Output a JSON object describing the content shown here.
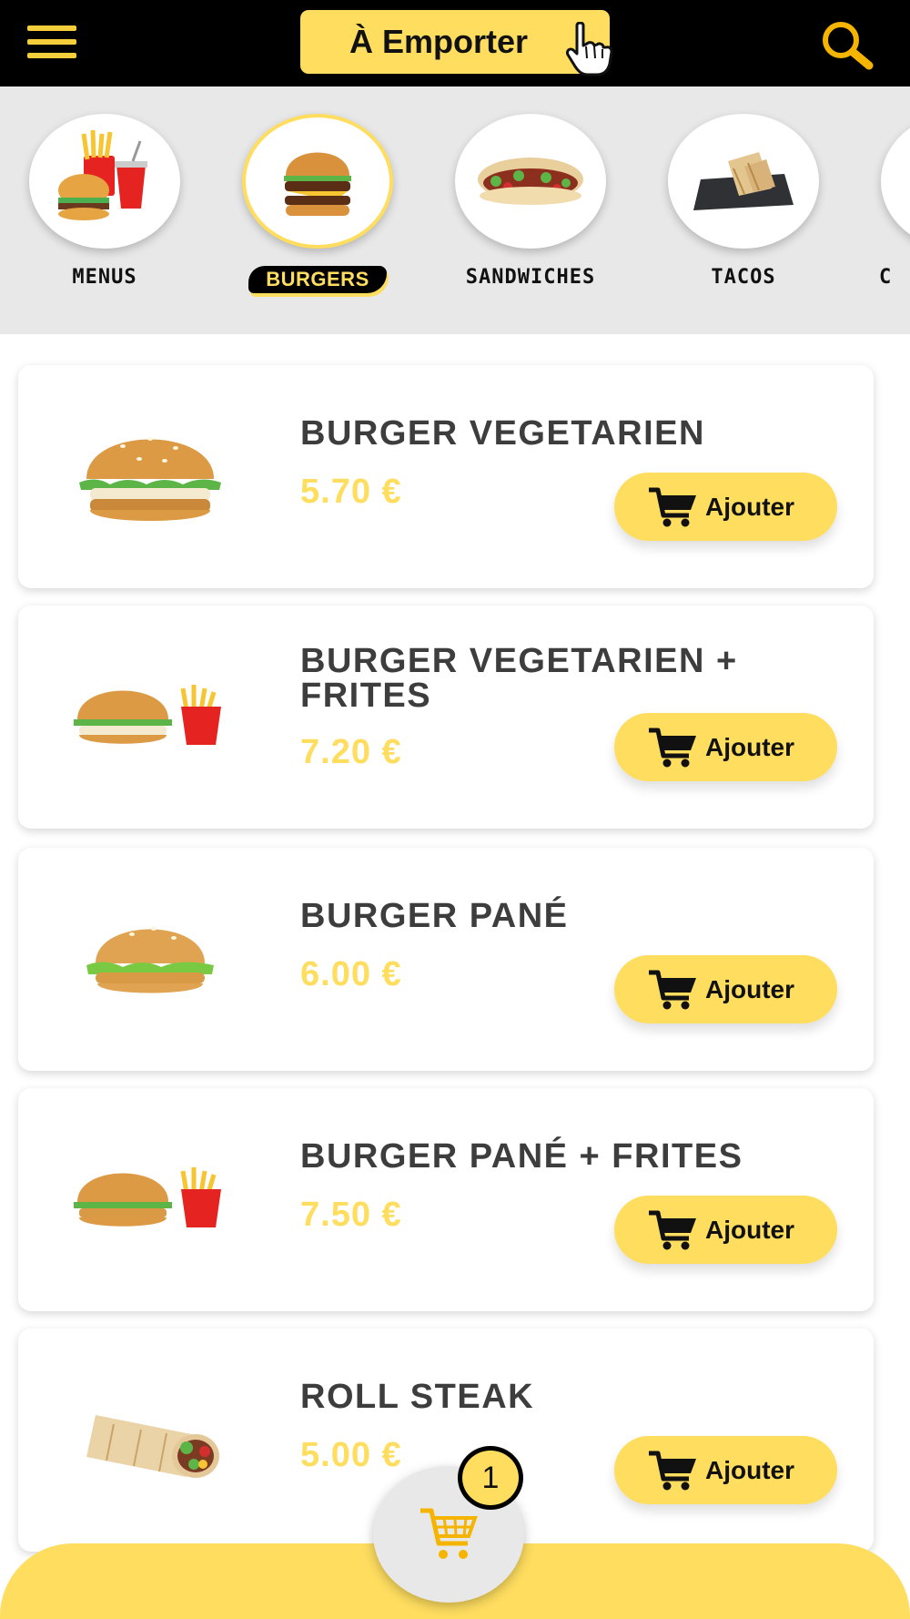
{
  "header": {
    "mode_label": "À Emporter"
  },
  "categories": [
    {
      "label": "MENUS",
      "active": false
    },
    {
      "label": "BURGERS",
      "active": true
    },
    {
      "label": "SANDWICHES",
      "active": false
    },
    {
      "label": "TACOS",
      "active": false
    },
    {
      "label": "C",
      "active": false
    }
  ],
  "products": [
    {
      "name": "BURGER VEGETARIEN",
      "price": "5.70 €",
      "add_label": "Ajouter"
    },
    {
      "name": "BURGER VEGETARIEN + FRITES",
      "price": "7.20 €",
      "add_label": "Ajouter"
    },
    {
      "name": "BURGER PANÉ",
      "price": "6.00 €",
      "add_label": "Ajouter"
    },
    {
      "name": "BURGER PANÉ + FRITES",
      "price": "7.50 €",
      "add_label": "Ajouter"
    },
    {
      "name": "ROLL STEAK",
      "price": "5.00 €",
      "add_label": "Ajouter"
    }
  ],
  "cart": {
    "count": "1"
  },
  "icons": {
    "menu": "hamburger-menu-icon",
    "search": "search-icon",
    "pointer": "hand-pointer-icon",
    "cart": "shopping-cart-icon"
  },
  "colors": {
    "accent": "#fedd5f",
    "header_bg": "#000000",
    "category_bg": "#e8e8e8",
    "title_text": "#3d3d3d"
  }
}
